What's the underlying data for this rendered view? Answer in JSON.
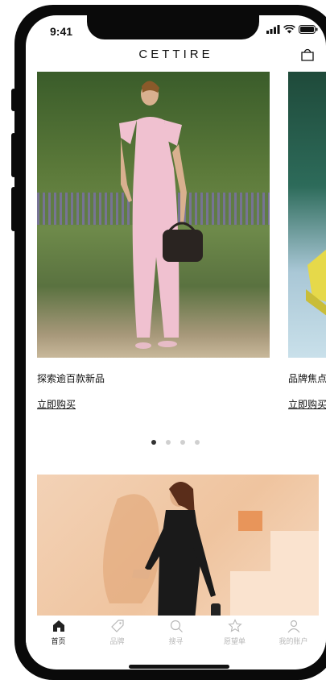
{
  "status_bar": {
    "time": "9:41"
  },
  "header": {
    "brand": "CETTIRE"
  },
  "carousel": {
    "cards": [
      {
        "caption": "探索逾百款新品",
        "link": "立即购买"
      },
      {
        "caption": "品牌焦点",
        "link": "立即购买"
      }
    ],
    "page_count": 4,
    "active_index": 0
  },
  "tabbar": {
    "items": [
      {
        "label": "首页",
        "icon": "home-icon",
        "active": true
      },
      {
        "label": "品牌",
        "icon": "tag-icon",
        "active": false
      },
      {
        "label": "搜寻",
        "icon": "search-icon",
        "active": false
      },
      {
        "label": "愿望单",
        "icon": "star-icon",
        "active": false
      },
      {
        "label": "我的账户",
        "icon": "user-icon",
        "active": false
      }
    ]
  },
  "colors": {
    "text": "#111111",
    "inactive": "#b8b8b8",
    "frame": "#0a0a0a"
  }
}
